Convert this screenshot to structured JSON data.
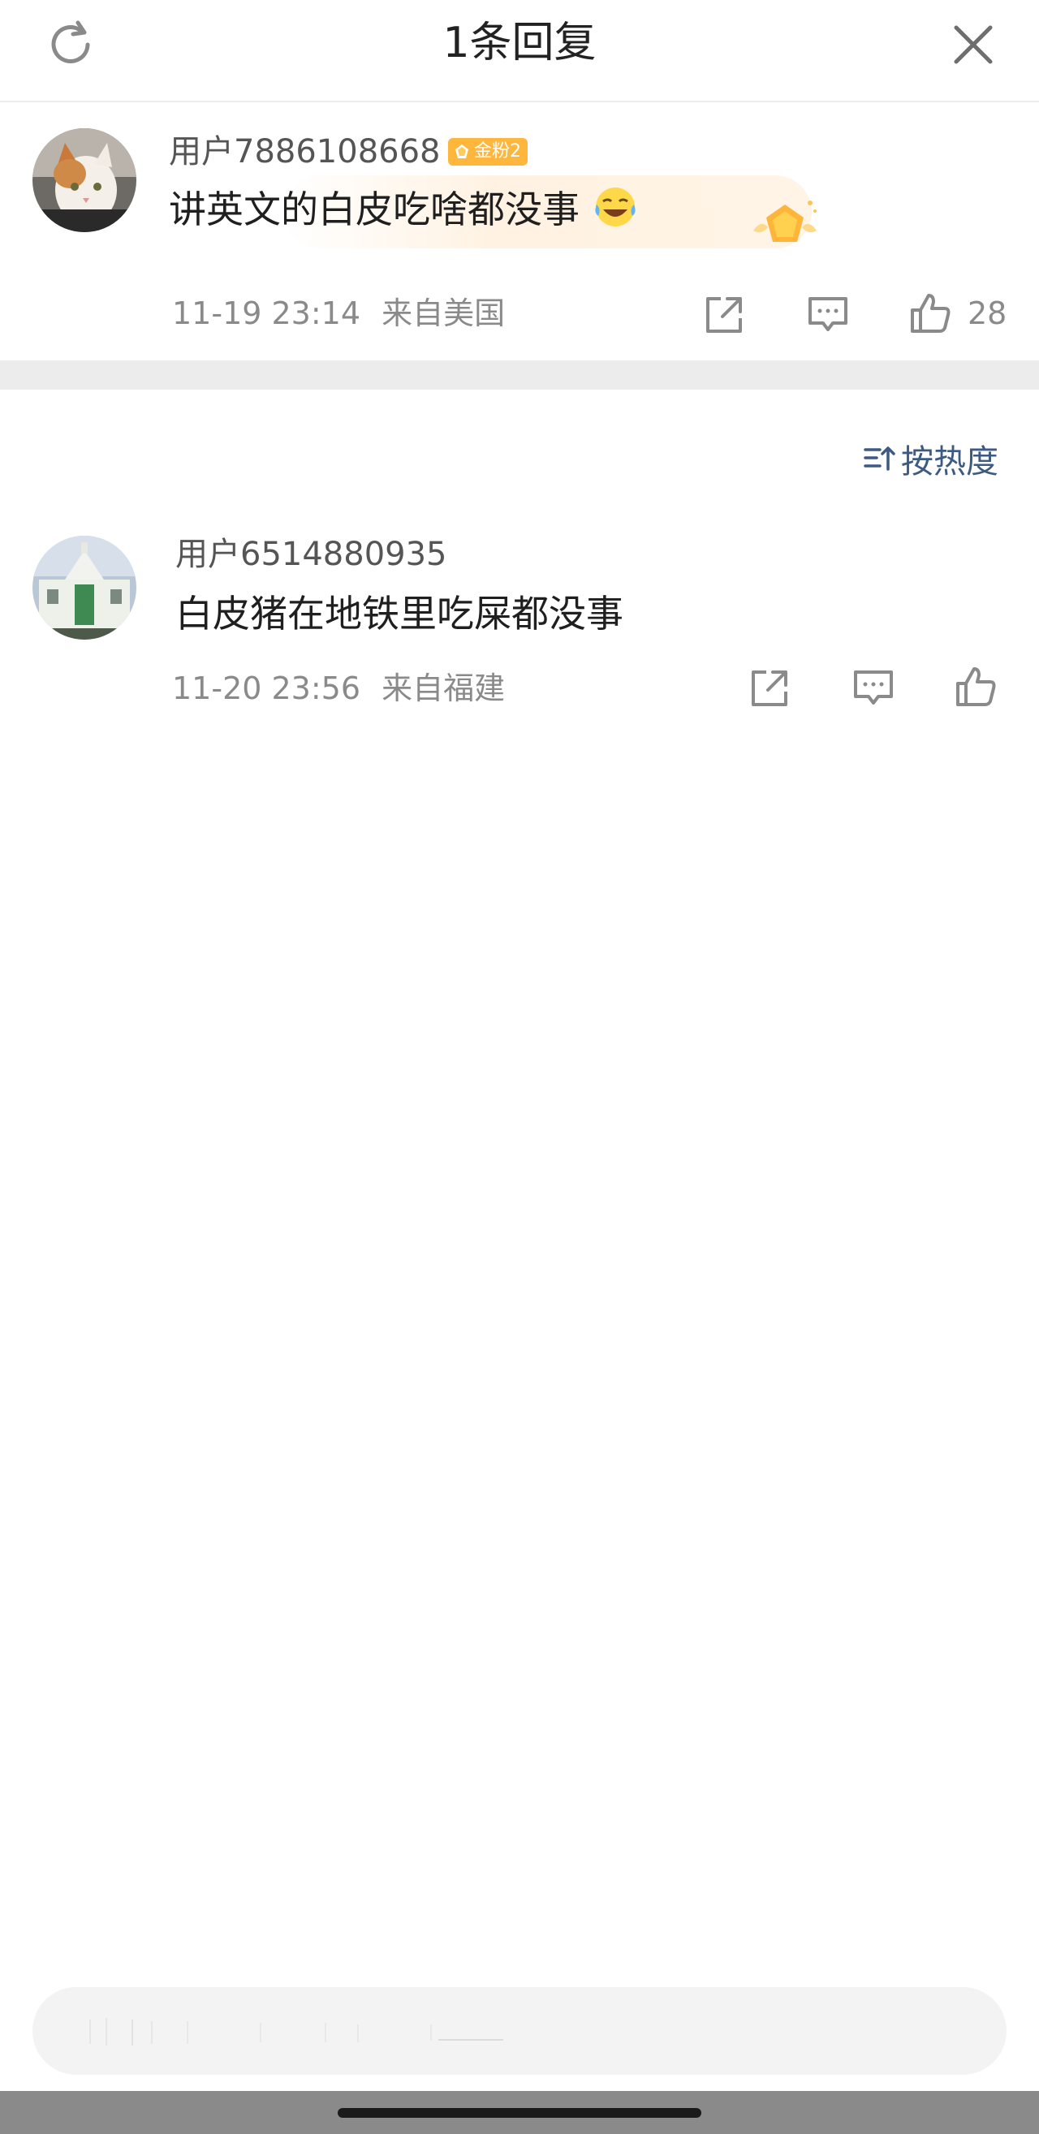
{
  "header": {
    "title": "1条回复"
  },
  "main_comment": {
    "username": "用户7886108668",
    "badge": "金粉2",
    "text": "讲英文的白皮吃啥都没事",
    "emoji": "laugh-cry-emoji",
    "time": "11-19 23:14",
    "location": "来自美国",
    "like_count": "28",
    "avatar": "cat-avatar"
  },
  "sort": {
    "label": "按热度"
  },
  "replies": [
    {
      "username": "用户6514880935",
      "text": "白皮猪在地铁里吃屎都没事",
      "time": "11-20 23:56",
      "location": "来自福建",
      "avatar": "building-avatar"
    }
  ],
  "input": {
    "placeholder": ""
  },
  "colors": {
    "accent": "#3d5a83",
    "badge": "#ffb63d",
    "separator": "#ececec"
  }
}
